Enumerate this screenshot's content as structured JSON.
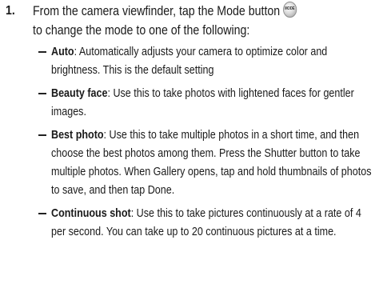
{
  "step": {
    "number": "1.",
    "line1": "From the camera viewfinder, tap the Mode button",
    "line2": "to change the mode to one of the following:",
    "icon_label": "MODE"
  },
  "modes": [
    {
      "title": "Auto",
      "text": ": Automatically adjusts your camera to optimize color and brightness. This is the default setting"
    },
    {
      "title": "Beauty face",
      "text": ": Use this to take photos with lightened faces for gentler images."
    },
    {
      "title": "Best photo",
      "text": ": Use this to take multiple photos in a short time, and then choose the best photos among them. Press the Shutter button to take multiple photos. When Gallery opens, tap and hold thumbnails of photos to save, and then tap Done."
    },
    {
      "title": "Continuous shot",
      "text": ": Use this to take pictures continuously at a rate of 4 per second. You can take up to 20 continuous pictures at a time."
    }
  ]
}
